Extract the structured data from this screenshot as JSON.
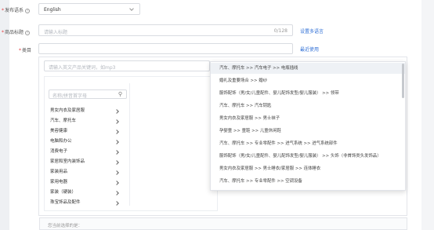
{
  "form": {
    "language_label": "发布语系",
    "language_value": "English",
    "title_label": "商品标题",
    "title_placeholder": "请输入标题",
    "title_counter": "0/128",
    "multi_language_link": "设置多语言",
    "category_label": "类目",
    "recent_link": "最近使用"
  },
  "category_panel": {
    "search_placeholder": "请输入英文产品关键词，如mp3",
    "filter_placeholder": "名称/拼音首字母",
    "categories": [
      "男女内衣及家居服",
      "汽车、摩托车",
      "美容健康",
      "电脑和办公",
      "消费电子",
      "家居和室内装饰品",
      "家装用品",
      "家用电器",
      "家装（硬装）",
      "珠宝饰品及配件"
    ],
    "selected_label": "您当前选择的是："
  },
  "recent_dropdown": {
    "items": [
      "汽车、摩托车 >> 汽车电子 >> 电瓶插线",
      "婚礼及重要场合 >> 婚纱",
      "服饰配饰（男/女/儿童配件、婴儿配饰发型/婴儿服装） >> 领带",
      "汽车、摩托车 >> 汽车钥匙",
      "男女内衣及家居服 >> 男士袜子",
      "孕婴童 >> 童鞋 >> 儿童休闲鞋",
      "汽车、摩托车 >> 专业零配件 >> 进气系统 >> 进气系统部件",
      "服饰配饰（男/女/儿童配件、婴儿配饰发型/婴儿服装） >> 头饰（非首饰类头发饰品）",
      "男女内衣及家居服 >> 男士睡衣/家居服 >> 连体睡衣",
      "汽车、摩托车 >> 专业零配件 >> 空调设备"
    ]
  }
}
